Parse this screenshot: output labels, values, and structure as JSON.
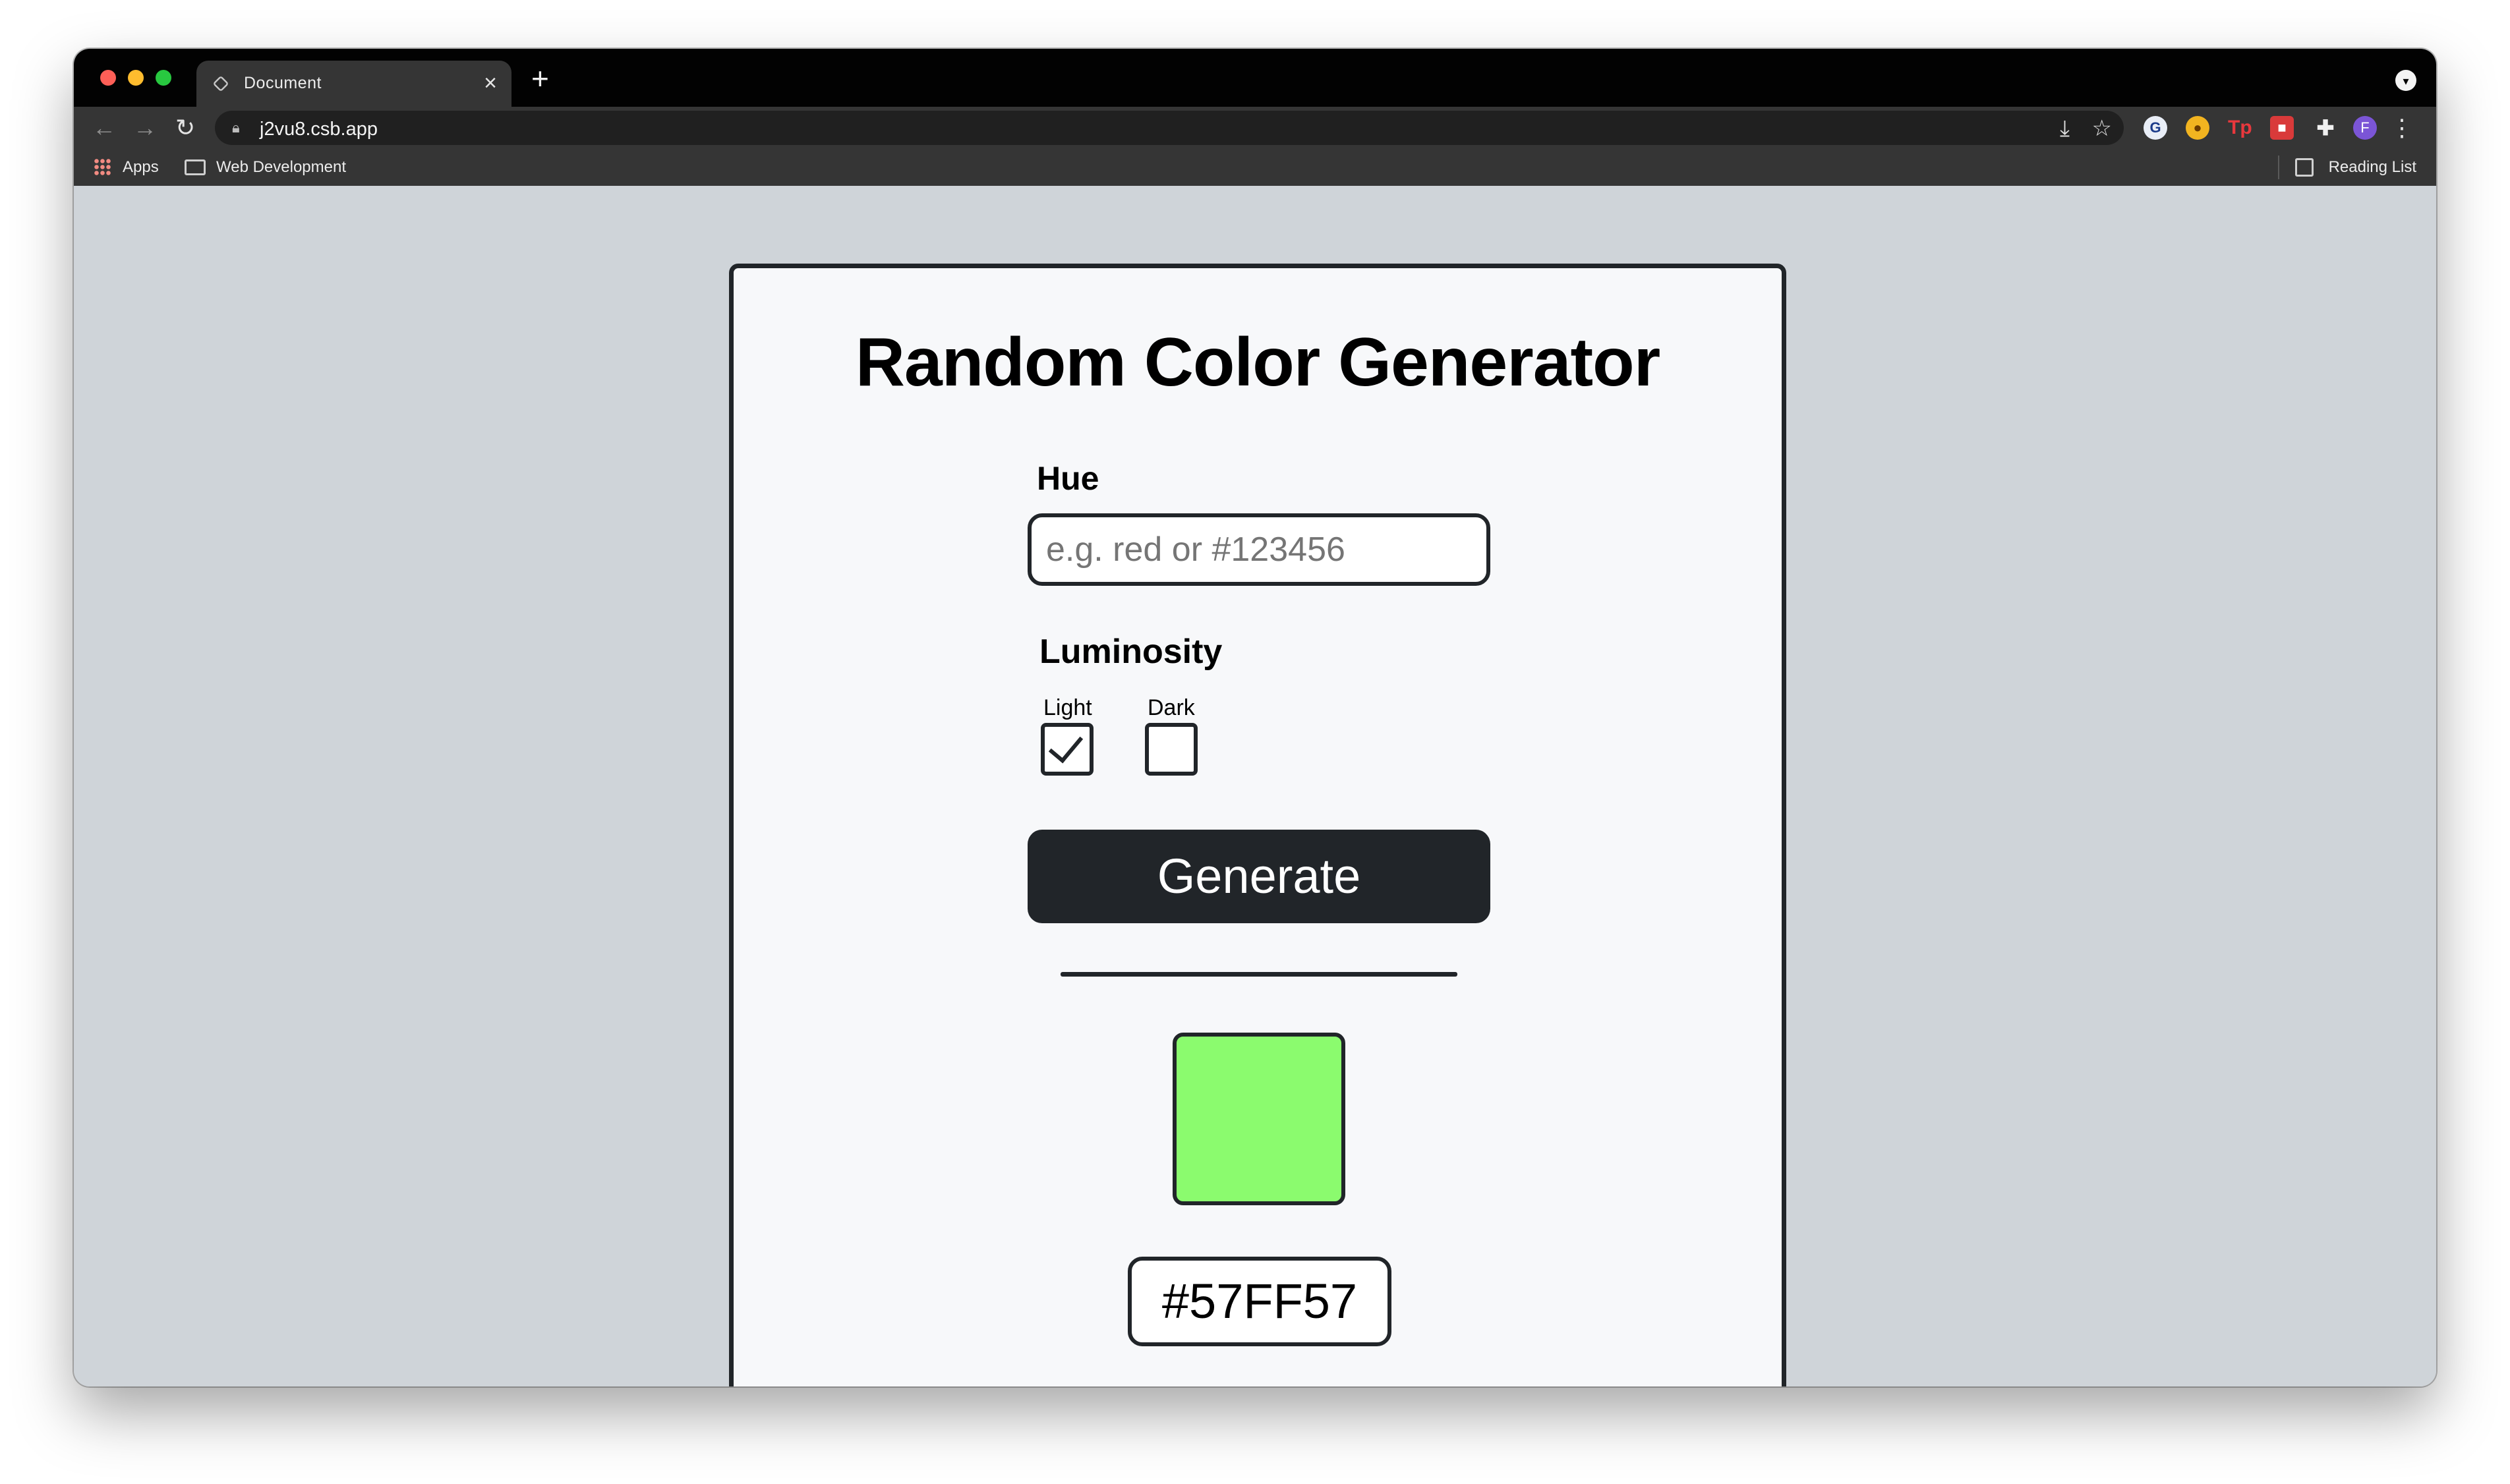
{
  "browser": {
    "tab_title": "Document",
    "tab_close": "×",
    "new_tab": "+",
    "url": "j2vu8.csb.app",
    "profile_initial": "F",
    "bookmarks": {
      "apps": "Apps",
      "web_development": "Web Development",
      "reading_list": "Reading List"
    }
  },
  "page": {
    "title": "Random Color Generator",
    "hue_label": "Hue",
    "hue_placeholder": "e.g. red or #123456",
    "hue_value": "",
    "luminosity_label": "Luminosity",
    "options": {
      "light_label": "Light",
      "light_checked": true,
      "dark_label": "Dark",
      "dark_checked": false
    },
    "generate_label": "Generate",
    "result_hex": "#57FF57"
  },
  "colors": {
    "swatch": "#8bfb6e",
    "dark": "#212529",
    "card_bg": "#f7f8fa",
    "page_bg": "#cfd4d9"
  },
  "icons": {
    "traffic_lights": [
      "close-dot",
      "minimize-dot",
      "zoom-dot"
    ],
    "toolbar": [
      "back-arrow-icon",
      "forward-arrow-icon",
      "reload-icon",
      "lock-icon",
      "install-icon",
      "star-icon",
      "puzzle-icon",
      "menu-dots-icon"
    ]
  }
}
